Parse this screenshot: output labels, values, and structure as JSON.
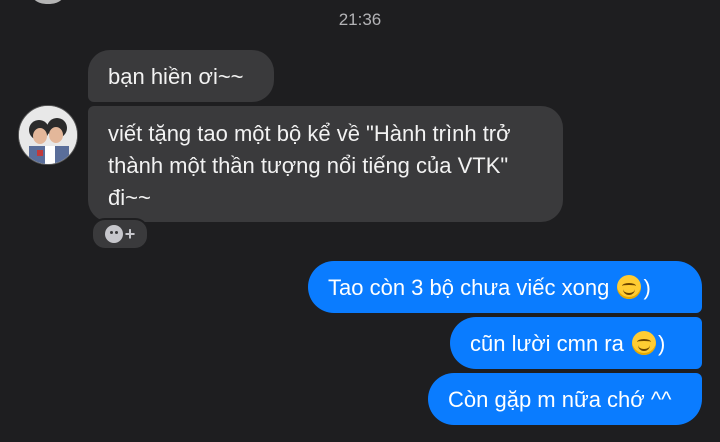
{
  "conversation": {
    "timestamp": "21:36",
    "messages": [
      {
        "from": "them",
        "text": "bạn hiền ơi~~"
      },
      {
        "from": "them",
        "text": "viết tặng tao một bộ kể về \"Hành trình trở thành một thần tượng nổi tiếng của VTK\" đi~~"
      },
      {
        "from": "me",
        "text": "Tao còn 3 bộ chưa viếc xong",
        "suffix": ")"
      },
      {
        "from": "me",
        "text": "cũn lười cmn ra",
        "suffix": ")"
      },
      {
        "from": "me",
        "text": "Còn gặp m nữa chớ ^^"
      }
    ]
  },
  "colors": {
    "background": "#1e1e20",
    "incoming_bubble": "#3a3a3c",
    "outgoing_bubble": "#0a7cff"
  },
  "icons": {
    "reaction": "smiley-add-icon",
    "emoji": "smiling-face-icon"
  }
}
